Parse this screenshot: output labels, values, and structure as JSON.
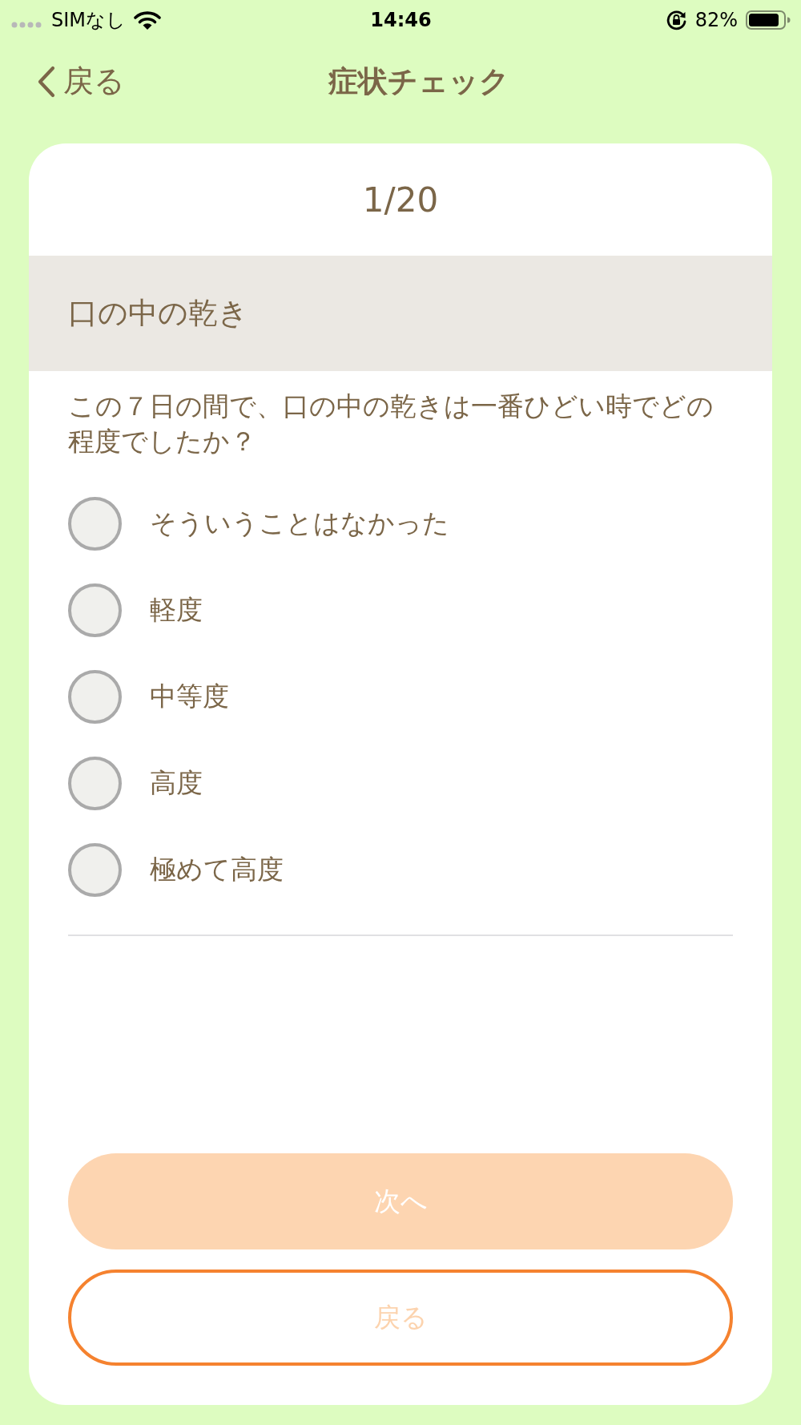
{
  "status_bar": {
    "carrier": "SIMなし",
    "time": "14:46",
    "battery": "82%"
  },
  "nav_bar": {
    "back_label": "戻る",
    "title": "症状チェック"
  },
  "card": {
    "progress": "1/20",
    "symptom": "口の中の乾き",
    "question": "この７日の間で、口の中の乾きは一番ひどい時でどの程度でしたか？",
    "options": [
      {
        "label": "そういうことはなかった",
        "selected": false
      },
      {
        "label": "軽度",
        "selected": false
      },
      {
        "label": "中等度",
        "selected": false
      },
      {
        "label": "高度",
        "selected": false
      },
      {
        "label": "極めて高度",
        "selected": false
      }
    ],
    "buttons": [
      {
        "label": "次へ",
        "kind": "filled",
        "disabled": true
      },
      {
        "label": "戻る",
        "kind": "outline",
        "disabled": true
      }
    ]
  }
}
